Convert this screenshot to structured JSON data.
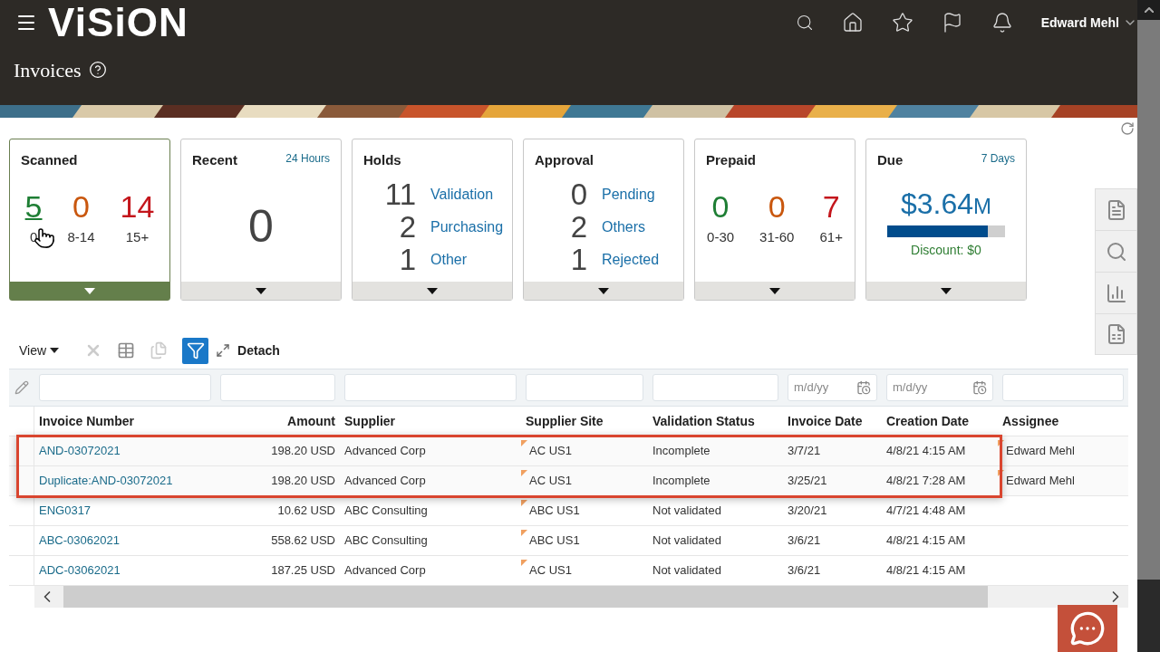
{
  "header": {
    "logo": "ViSiON",
    "user": "Edward Mehl",
    "page_title": "Invoices"
  },
  "cards": [
    {
      "kind": "aging",
      "title": "Scanned",
      "selected": true,
      "buckets": [
        {
          "value": "5",
          "label": "0",
          "color": "#1e7e34"
        },
        {
          "value": "0",
          "label": "8-14",
          "color": "#c9570e"
        },
        {
          "value": "14",
          "label": "15+",
          "color": "#c4161c"
        }
      ]
    },
    {
      "kind": "single",
      "title": "Recent",
      "badge": "24 Hours",
      "selected": false,
      "value": "0"
    },
    {
      "kind": "list",
      "title": "Holds",
      "selected": false,
      "items": [
        {
          "count": "11",
          "label": "Validation"
        },
        {
          "count": "2",
          "label": "Purchasing"
        },
        {
          "count": "1",
          "label": "Other"
        }
      ]
    },
    {
      "kind": "list",
      "title": "Approval",
      "selected": false,
      "items": [
        {
          "count": "0",
          "label": "Pending"
        },
        {
          "count": "2",
          "label": "Others"
        },
        {
          "count": "1",
          "label": "Rejected"
        }
      ]
    },
    {
      "kind": "aging",
      "title": "Prepaid",
      "selected": false,
      "buckets": [
        {
          "value": "0",
          "label": "0-30",
          "color": "#1e7e34"
        },
        {
          "value": "0",
          "label": "31-60",
          "color": "#c9570e"
        },
        {
          "value": "7",
          "label": "61+",
          "color": "#c4161c"
        }
      ]
    },
    {
      "kind": "amount",
      "title": "Due",
      "badge": "7 Days",
      "selected": false,
      "amount": "$3.64",
      "unit": "M",
      "level": 0.85,
      "note": "Discount: $0"
    }
  ],
  "toolbar": {
    "view": "View",
    "detach": "Detach"
  },
  "columns": [
    {
      "label": "Invoice Number",
      "kind": "link"
    },
    {
      "label": "Amount",
      "kind": "number"
    },
    {
      "label": "Supplier",
      "kind": "text"
    },
    {
      "label": "Supplier Site",
      "kind": "flagged"
    },
    {
      "label": "Validation Status",
      "kind": "text"
    },
    {
      "label": "Invoice Date",
      "kind": "date",
      "placeholder": "m/d/yy"
    },
    {
      "label": "Creation Date",
      "kind": "date",
      "placeholder": "m/d/yy"
    },
    {
      "label": "Assignee",
      "kind": "flagged"
    }
  ],
  "rows": [
    {
      "cells": [
        "AND-03072021",
        "198.20 USD",
        "Advanced Corp",
        "AC US1",
        "Incomplete",
        "3/7/21",
        "4/8/21 4:15 AM",
        "Edward Mehl"
      ],
      "highlighted": true
    },
    {
      "cells": [
        "Duplicate:AND-03072021",
        "198.20 USD",
        "Advanced Corp",
        "AC US1",
        "Incomplete",
        "3/25/21",
        "4/8/21 7:28 AM",
        "Edward Mehl"
      ],
      "highlighted": true
    },
    {
      "cells": [
        "ENG0317",
        "10.62 USD",
        "ABC Consulting",
        "ABC US1",
        "Not validated",
        "3/20/21",
        "4/7/21 4:48 AM"
      ],
      "highlighted": false
    },
    {
      "cells": [
        "ABC-03062021",
        "558.62 USD",
        "ABC Consulting",
        "ABC US1",
        "Not validated",
        "3/6/21",
        "4/8/21 4:15 AM"
      ],
      "highlighted": false
    },
    {
      "cells": [
        "ADC-03062021",
        "187.25 USD",
        "Advanced Corp",
        "AC US1",
        "Not validated",
        "3/6/21",
        "4/8/21 4:15 AM"
      ],
      "highlighted": false
    }
  ]
}
